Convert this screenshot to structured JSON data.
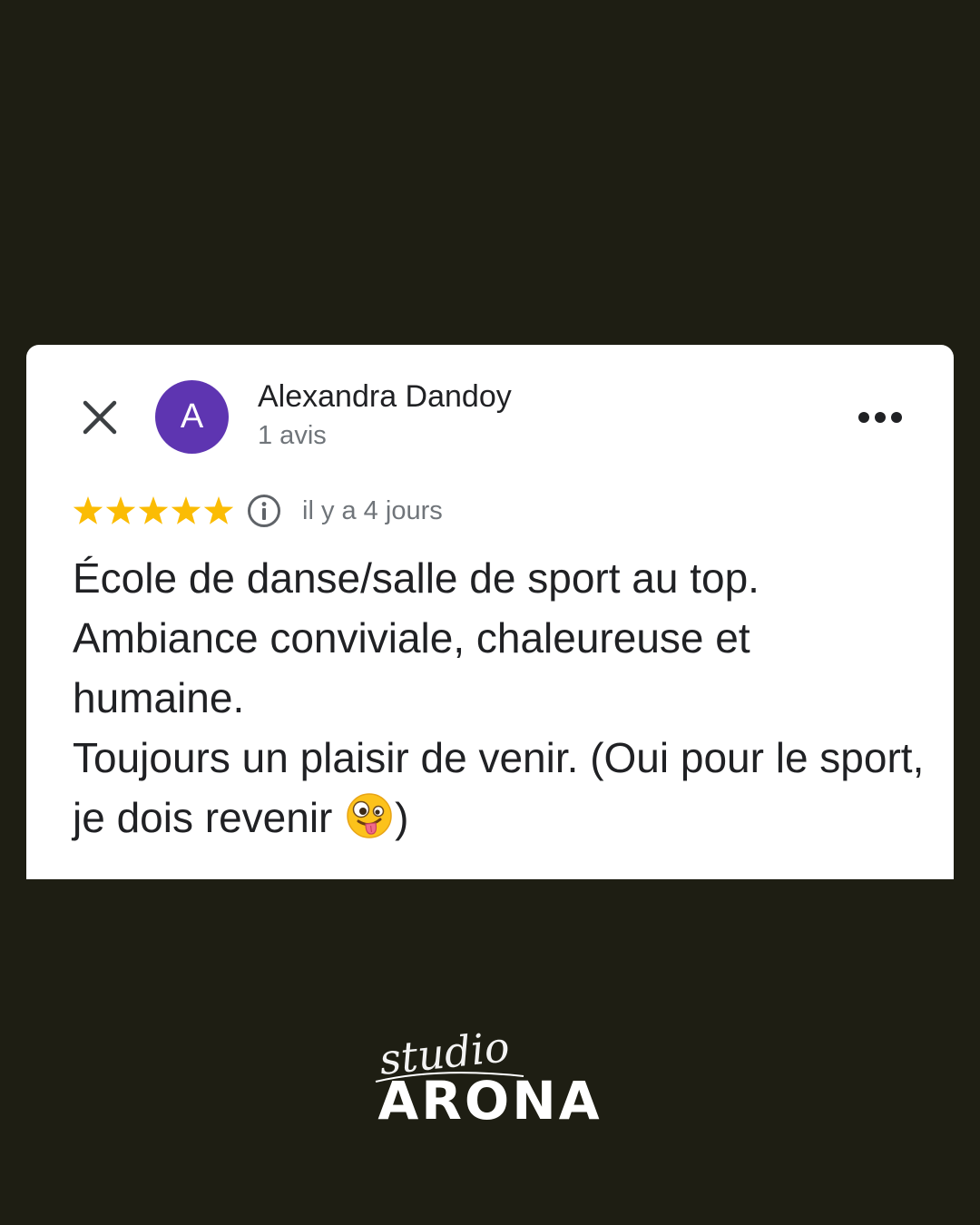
{
  "review": {
    "close_icon": "close-icon",
    "more_icon": "more-options-icon",
    "author": {
      "initial": "A",
      "name": "Alexandra Dandoy",
      "review_count": "1 avis",
      "avatar_color": "#5e35b1"
    },
    "rating": {
      "stars": 5,
      "max": 5,
      "star_color": "#fbbc04"
    },
    "info_icon": "info-icon",
    "date": "il y a 4 jours",
    "text": {
      "line1": "École de danse/salle de sport au top.",
      "line2": "Ambiance conviviale, chaleureuse et humaine.",
      "line3_before_emoji": "Toujours un plaisir de venir. (Oui pour le sport, je dois revenir",
      "emoji": "zany-face-emoji",
      "line3_after_emoji": ")"
    }
  },
  "brand": {
    "logo_script": "studio",
    "logo_name": "ARONA"
  },
  "colors": {
    "background": "#1e1e13",
    "card": "#ffffff",
    "text_primary": "#202124",
    "text_secondary": "#70757a"
  }
}
